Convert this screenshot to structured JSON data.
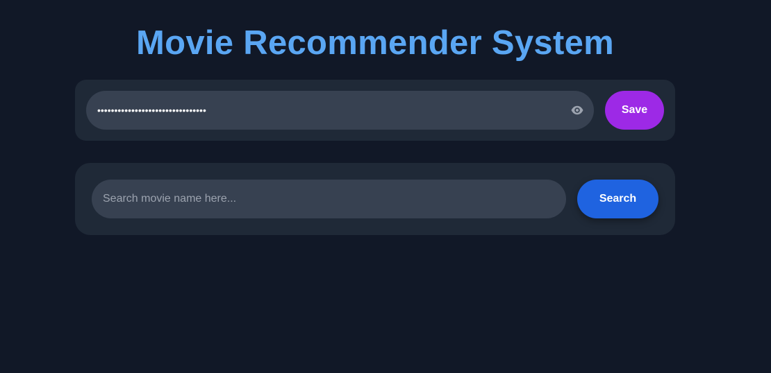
{
  "header": {
    "title": "Movie Recommender System"
  },
  "api_key": {
    "value": "********************************",
    "save_label": "Save",
    "toggle_icon": "eye-icon"
  },
  "search": {
    "placeholder": "Search movie name here...",
    "value": "",
    "button_label": "Search"
  },
  "colors": {
    "background": "#111827",
    "panel": "#1f2937",
    "field": "#374151",
    "title": "#5aa6f3",
    "save_button": "#9d29e6",
    "search_button": "#1f63e0"
  }
}
